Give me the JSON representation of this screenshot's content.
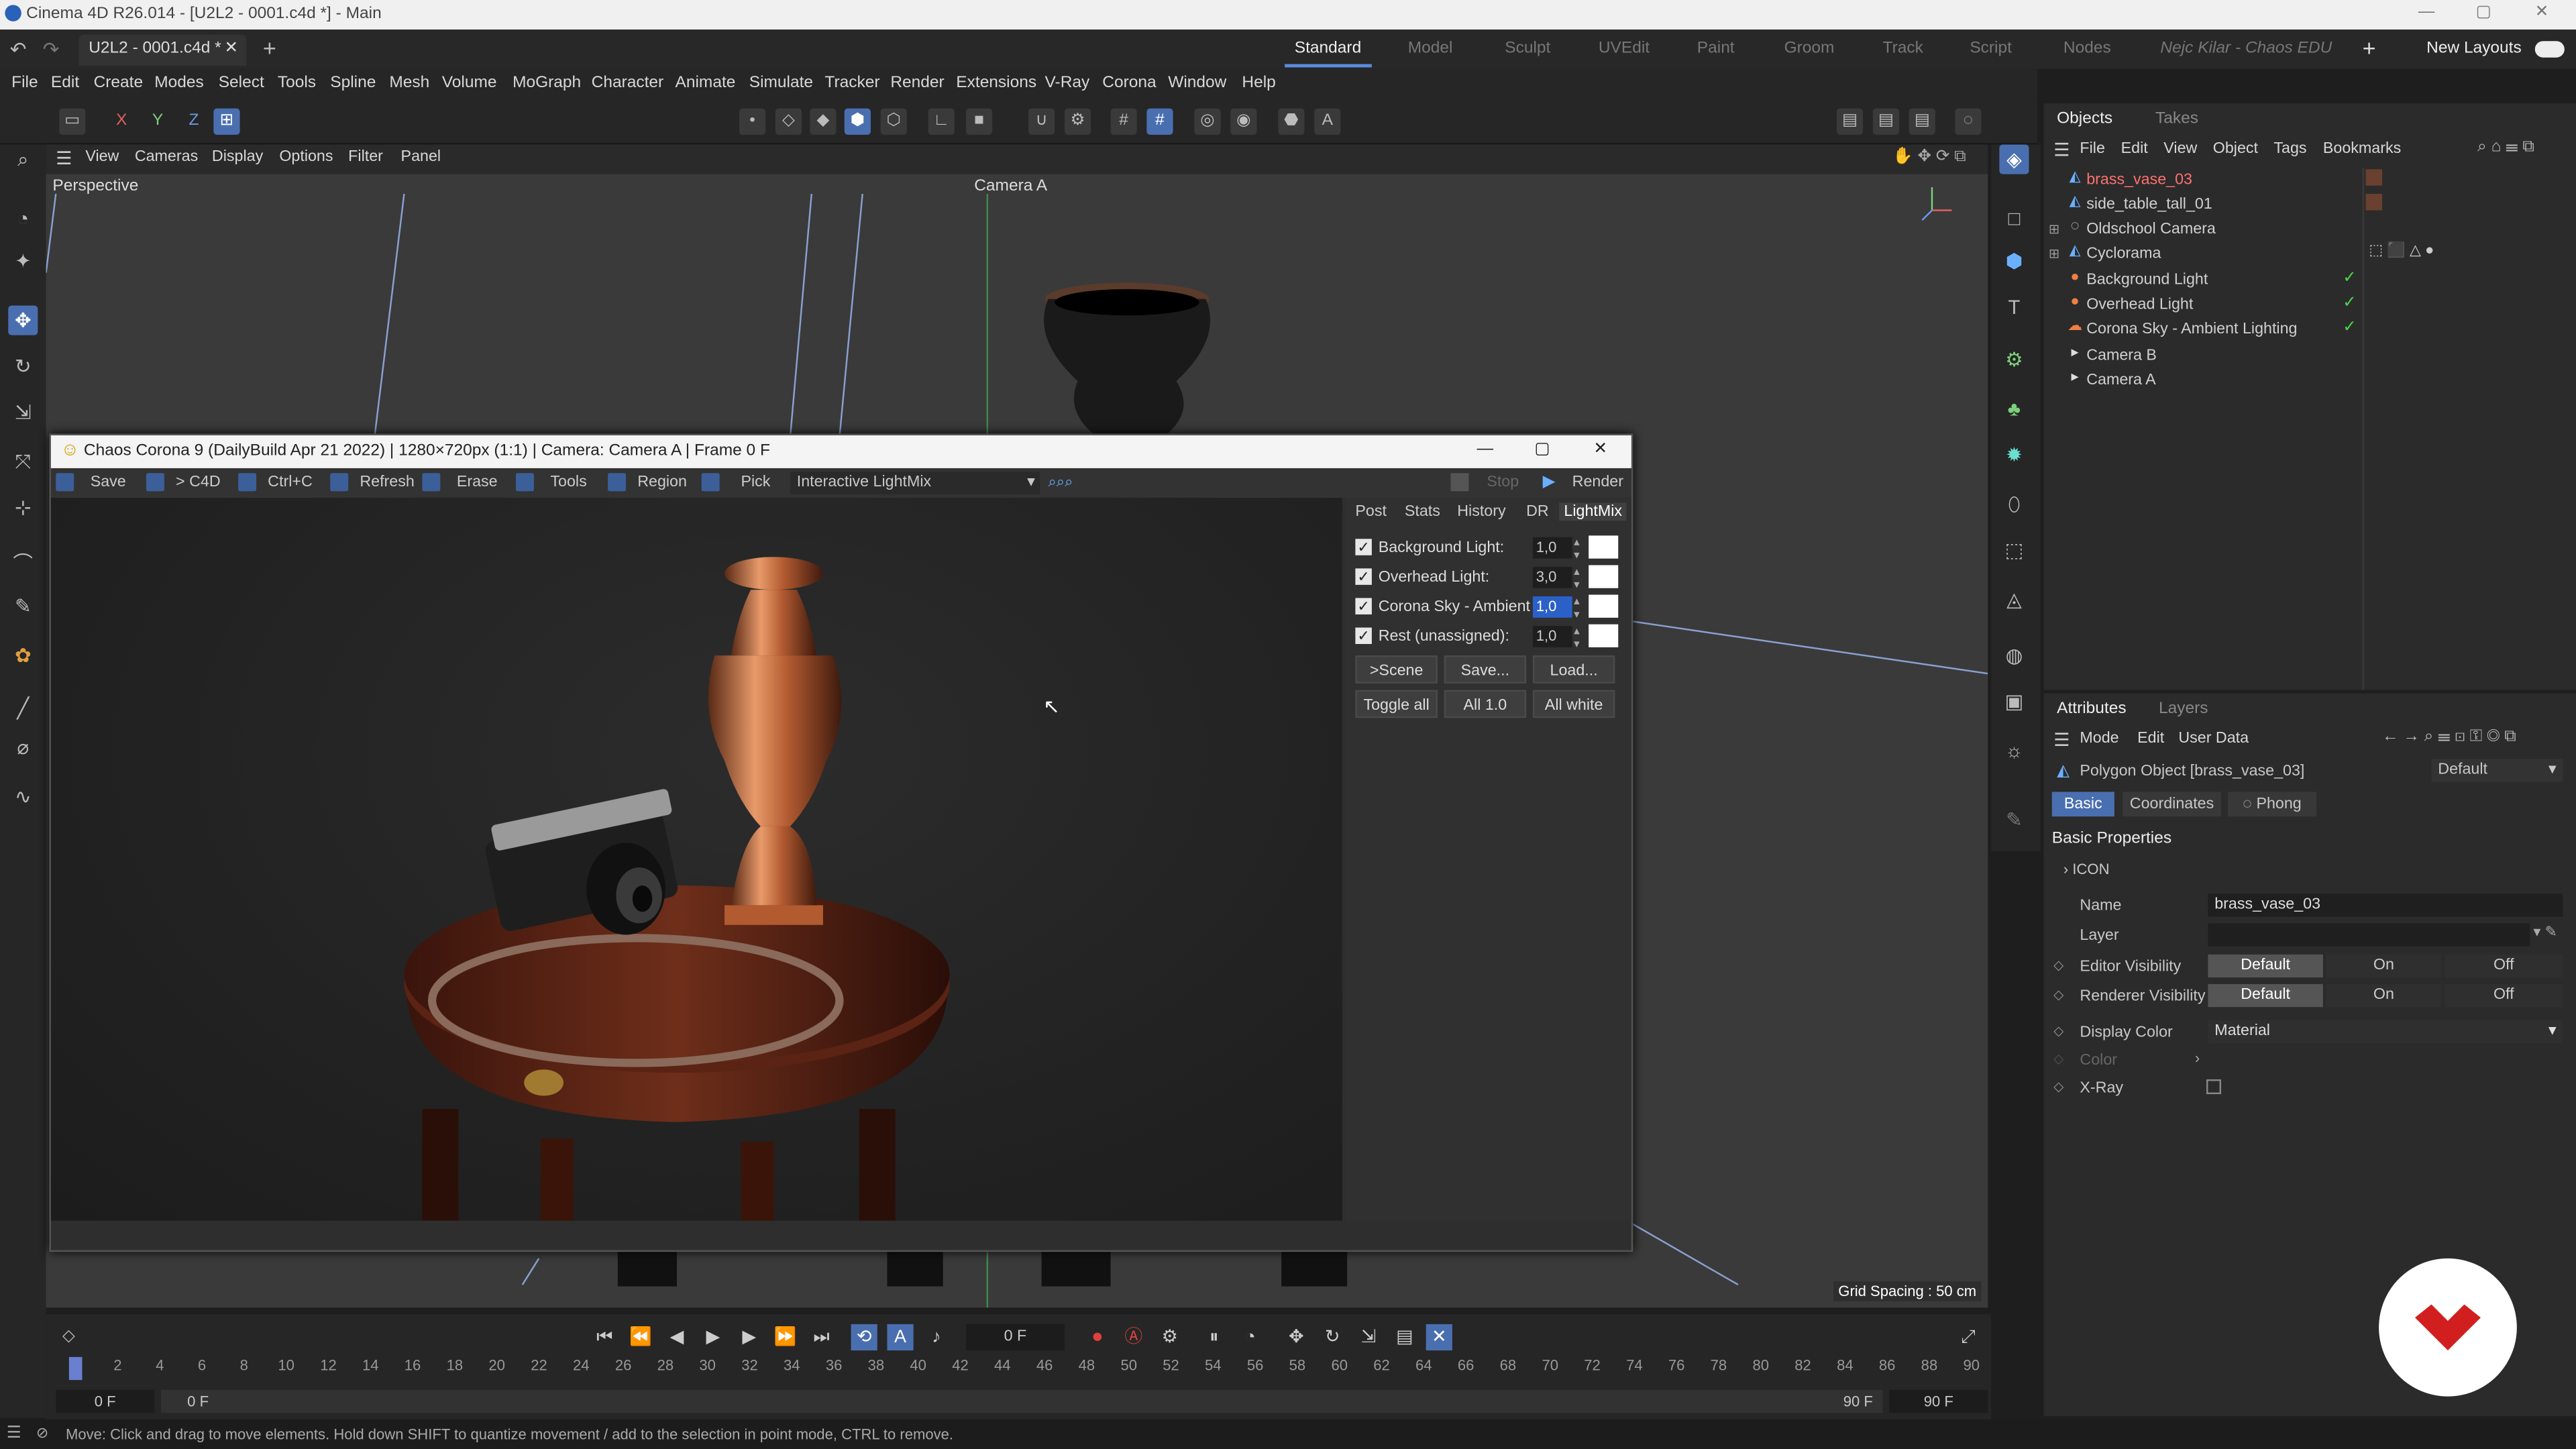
{
  "app": {
    "title": "Cinema 4D R26.014 - [U2L2 - 0001.c4d *] - Main",
    "doc_tab": "U2L2 - 0001.c4d *"
  },
  "layouts": [
    "Standard",
    "Model",
    "Sculpt",
    "UVEdit",
    "Paint",
    "Groom",
    "Track",
    "Script",
    "Nodes",
    "Nejc Kilar - Chaos EDU"
  ],
  "new_layouts": "New Layouts",
  "menu": [
    "File",
    "Edit",
    "Create",
    "Modes",
    "Select",
    "Tools",
    "Spline",
    "Mesh",
    "Volume",
    "MoGraph",
    "Character",
    "Animate",
    "Simulate",
    "Tracker",
    "Render",
    "Extensions",
    "V-Ray",
    "Corona",
    "Window",
    "Help"
  ],
  "axis_toolbar": [
    "X",
    "Y",
    "Z"
  ],
  "viewport": {
    "menu": [
      "View",
      "Cameras",
      "Display",
      "Options",
      "Filter",
      "Panel"
    ],
    "label": "Perspective",
    "camera": "Camera A",
    "grid_spacing": "Grid Spacing : 50 cm"
  },
  "objects_panel": {
    "tabs": [
      "Objects",
      "Takes"
    ],
    "menu": [
      "File",
      "Edit",
      "View",
      "Object",
      "Tags",
      "Bookmarks"
    ],
    "items": [
      {
        "name": "brass_vase_03",
        "icon": "polygon-icon",
        "selected": true
      },
      {
        "name": "side_table_tall_01",
        "icon": "polygon-icon"
      },
      {
        "name": "Oldschool Camera",
        "icon": "null-icon"
      },
      {
        "name": "Cyclorama",
        "icon": "cyclorama-icon"
      },
      {
        "name": "Background Light",
        "icon": "light-icon",
        "check": true
      },
      {
        "name": "Overhead Light",
        "icon": "light-icon",
        "check": true
      },
      {
        "name": "Corona Sky - Ambient Lighting",
        "icon": "sky-icon",
        "check": true
      },
      {
        "name": "Camera B",
        "icon": "camera-icon"
      },
      {
        "name": "Camera A",
        "icon": "camera-icon"
      }
    ]
  },
  "attributes": {
    "tabs": [
      "Attributes",
      "Layers"
    ],
    "menu": [
      "Mode",
      "Edit",
      "User Data"
    ],
    "object": "Polygon Object [brass_vase_03]",
    "preset": "Default",
    "subtabs": [
      "Basic",
      "Coordinates",
      "Phong"
    ],
    "section": "Basic Properties",
    "icon_group": "ICON",
    "name_label": "Name",
    "name_value": "brass_vase_03",
    "layer_label": "Layer",
    "editor_visibility": "Editor Visibility",
    "renderer_visibility": "Renderer Visibility",
    "vis_options": [
      "Default",
      "On",
      "Off"
    ],
    "display_color": "Display Color",
    "display_color_value": "Material",
    "color_label": "Color",
    "xray_label": "X-Ray"
  },
  "corona": {
    "title": "Chaos Corona 9 (DailyBuild Apr 21 2022) | 1280×720px (1:1) | Camera: Camera A | Frame 0 F",
    "toolbar": [
      "Save",
      "> C4D",
      "Ctrl+C",
      "Refresh",
      "Erase",
      "Tools",
      "Region",
      "Pick"
    ],
    "mode": "Interactive LightMix",
    "stop": "Stop",
    "render": "Render",
    "panel_tabs": [
      "Post",
      "Stats",
      "History",
      "DR",
      "LightMix"
    ],
    "lights": [
      {
        "name": "Background Light:",
        "value": "1,0"
      },
      {
        "name": "Overhead Light:",
        "value": "3,0"
      },
      {
        "name": "Corona Sky - Ambient",
        "value": "1,0",
        "selected": true
      },
      {
        "name": "Rest (unassigned):",
        "value": "1,0"
      }
    ],
    "buttons_row1": [
      ">Scene",
      "Save...",
      "Load..."
    ],
    "buttons_row2": [
      "Toggle all",
      "All 1.0",
      "All white"
    ]
  },
  "timeline": {
    "current_frame": "0 F",
    "ticks": [
      "0",
      "2",
      "4",
      "6",
      "8",
      "10",
      "12",
      "14",
      "16",
      "18",
      "20",
      "22",
      "24",
      "26",
      "28",
      "30",
      "32",
      "34",
      "36",
      "38",
      "40",
      "42",
      "44",
      "46",
      "48",
      "50",
      "52",
      "54",
      "56",
      "58",
      "60",
      "62",
      "64",
      "66",
      "68",
      "70",
      "72",
      "74",
      "76",
      "78",
      "80",
      "82",
      "84",
      "86",
      "88",
      "90"
    ],
    "start": "0 F",
    "start2": "0 F",
    "end": "90 F",
    "end2": "90 F"
  },
  "status": "Move: Click and drag to move elements. Hold down SHIFT to quantize movement / add to the selection in point mode, CTRL to remove.",
  "colors": {
    "accent": "#4a6fb0",
    "check": "#4bd44b",
    "brand": "#d11f1f"
  }
}
